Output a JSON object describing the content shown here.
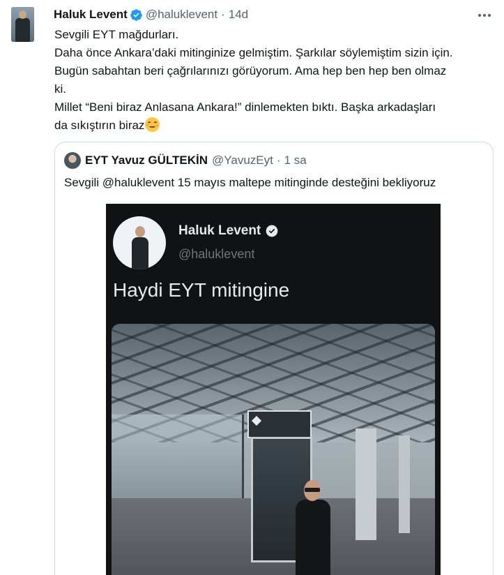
{
  "author": {
    "name": "Haluk Levent",
    "handle": "@haluklevent",
    "separator": "·",
    "time": "14d"
  },
  "tweet": {
    "lines": [
      "Sevgili EYT mağdurları.",
      "Daha önce Ankara’daki mitinginize gelmiştim. Şarkılar söylemiştim sizin için.",
      "Bugün sabahtan beri çağrılarınızı görüyorum. Ama hep ben hep ben olmaz",
      "ki.",
      "Millet “Beni biraz Anlasana Ankara!” dinlemekten bıktı. Başka arkadaşları",
      "da sıkıştırın biraz"
    ],
    "emoji": "smiling-face-emoji"
  },
  "quoted": {
    "name": "EYT Yavuz GÜLTEKİN",
    "handle": "@YavuzEyt",
    "separator": "·",
    "time": "1 sa",
    "text": "Sevgili @haluklevent 15 mayıs maltepe mitinginde desteğini bekliyoruz",
    "media": {
      "name": "Haluk Levent",
      "handle": "@haluklevent",
      "text": "Haydi EYT mitingine"
    }
  },
  "colors": {
    "verified": "#1d9bf0",
    "secondary_text": "#536471",
    "border": "#cfd9de"
  }
}
